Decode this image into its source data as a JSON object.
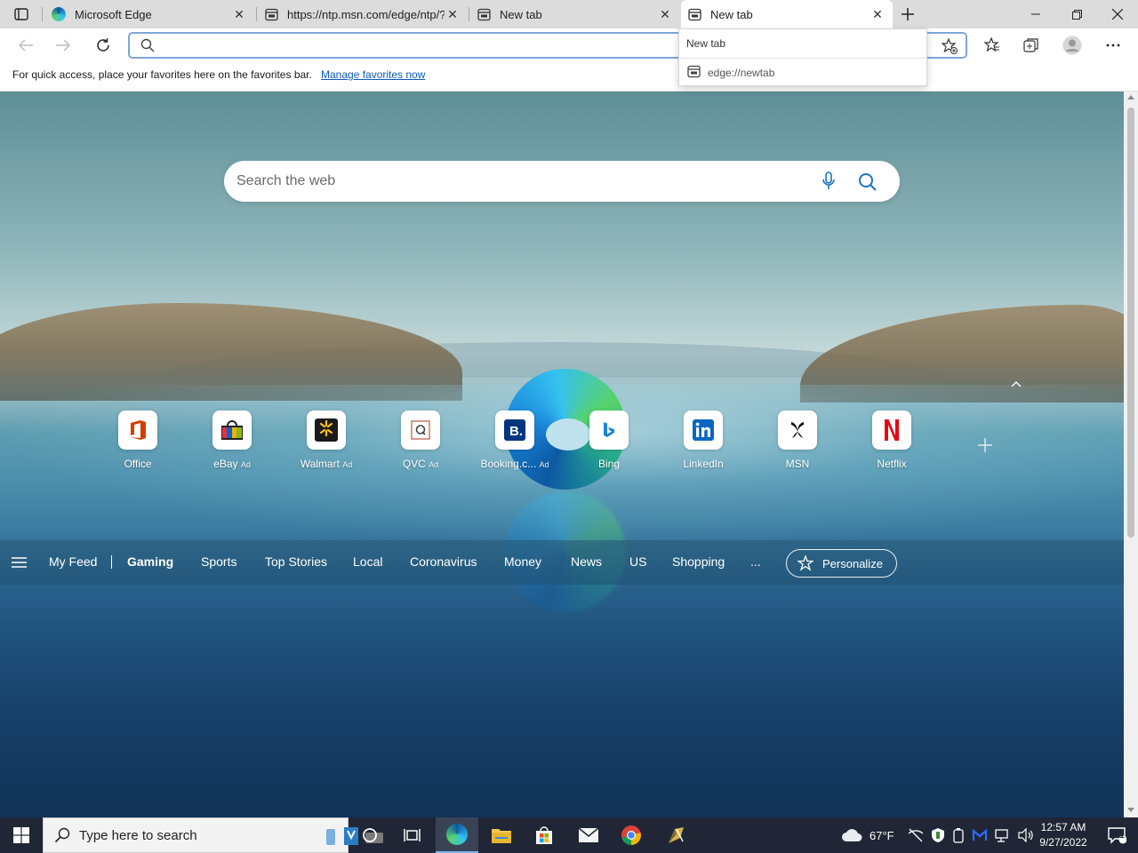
{
  "tabs": [
    {
      "title": "Microsoft Edge",
      "icon": "edge-icon"
    },
    {
      "title": "https://ntp.msn.com/edge/ntp/?",
      "icon": "page-icon"
    },
    {
      "title": "New tab",
      "icon": "page-icon"
    },
    {
      "title": "New tab",
      "icon": "page-icon",
      "active": true
    }
  ],
  "tab_hover": {
    "title": "New tab",
    "url": "edge://newtab"
  },
  "address": {
    "value": "",
    "placeholder": ""
  },
  "favbar": {
    "message": "For quick access, place your favorites here on the favorites bar.",
    "link": "Manage favorites now"
  },
  "search": {
    "placeholder": "Search the web"
  },
  "quick_links": [
    {
      "name": "Office",
      "ad": ""
    },
    {
      "name": "eBay",
      "ad": "Ad"
    },
    {
      "name": "Walmart",
      "ad": "Ad"
    },
    {
      "name": "QVC",
      "ad": "Ad"
    },
    {
      "name": "Booking.c...",
      "ad": "Ad"
    },
    {
      "name": "Bing",
      "ad": ""
    },
    {
      "name": "LinkedIn",
      "ad": ""
    },
    {
      "name": "MSN",
      "ad": ""
    },
    {
      "name": "Netflix",
      "ad": ""
    }
  ],
  "feed_nav": [
    "My Feed",
    "Gaming",
    "Sports",
    "Top Stories",
    "Local",
    "Coronavirus",
    "Money",
    "News",
    "US",
    "Shopping",
    "..."
  ],
  "feed_active": "Gaming",
  "personalize_label": "Personalize",
  "taskbar": {
    "search_placeholder": "Type here to search",
    "weather": "67°F",
    "time": "12:57 AM",
    "date": "9/27/2022",
    "notification_count": "1"
  },
  "colors": {
    "accent": "#0b59b8",
    "taskbar": "#202635",
    "tabstrip": "#dcdcdc"
  }
}
